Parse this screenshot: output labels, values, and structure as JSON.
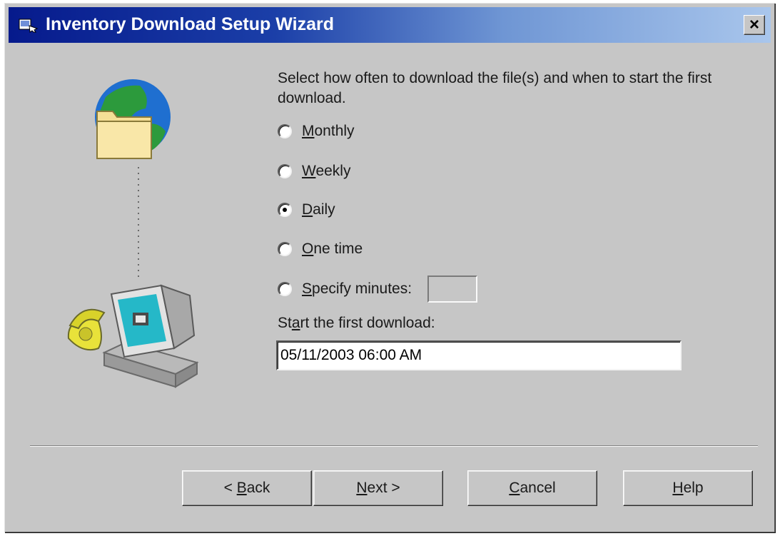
{
  "window": {
    "title": "Inventory Download Setup Wizard",
    "close_label": "×"
  },
  "content": {
    "prompt": "Select how often to download the file(s) and when to start the first download.",
    "frequency": {
      "selected": "Daily",
      "options": [
        {
          "mnemonic": "M",
          "rest": "onthly"
        },
        {
          "mnemonic": "W",
          "rest": "eekly"
        },
        {
          "mnemonic": "D",
          "rest": "aily"
        },
        {
          "mnemonic": "O",
          "rest": "ne time"
        },
        {
          "mnemonic": "S",
          "rest": "pecify minutes:"
        }
      ],
      "specify_minutes_value": ""
    },
    "start": {
      "label_pre": "St",
      "label_mnemonic": "a",
      "label_post": "rt the first download:",
      "value": "05/11/2003 06:00 AM"
    }
  },
  "buttons": {
    "back": {
      "pre": "< ",
      "mnemonic": "B",
      "post": "ack"
    },
    "next": {
      "mnemonic": "N",
      "post": "ext >"
    },
    "cancel": {
      "mnemonic": "C",
      "post": "ancel"
    },
    "help": {
      "mnemonic": "H",
      "post": "elp"
    }
  },
  "colors": {
    "title_bar_start": "#061a8c",
    "title_bar_end": "#a9c6ec",
    "dialog_background": "#c6c6c6"
  },
  "icons": [
    "wizard-app-icon",
    "close-icon",
    "globe-folder-icon",
    "computer-phone-icon"
  ]
}
